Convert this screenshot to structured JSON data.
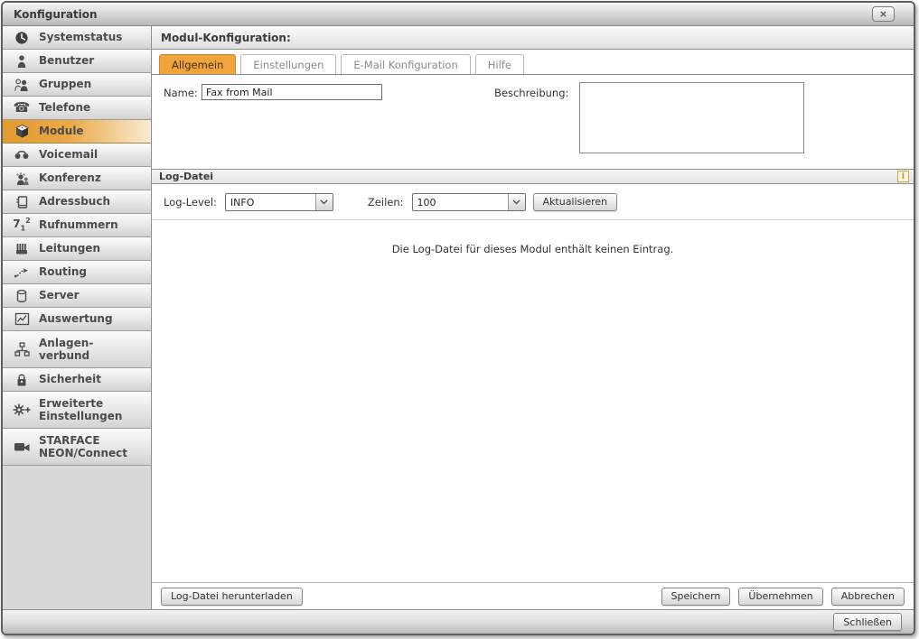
{
  "window": {
    "title": "Konfiguration",
    "close_glyph": "×"
  },
  "sidebar": {
    "items": [
      {
        "label": "Systemstatus",
        "icon": "clock-icon",
        "selected": false
      },
      {
        "label": "Benutzer",
        "icon": "user-icon",
        "selected": false
      },
      {
        "label": "Gruppen",
        "icon": "group-icon",
        "selected": false
      },
      {
        "label": "Telefone",
        "icon": "phone-icon",
        "selected": false
      },
      {
        "label": "Module",
        "icon": "cube-icon",
        "selected": true
      },
      {
        "label": "Voicemail",
        "icon": "voicemail-icon",
        "selected": false
      },
      {
        "label": "Konferenz",
        "icon": "conference-icon",
        "selected": false
      },
      {
        "label": "Adressbuch",
        "icon": "addressbook-icon",
        "selected": false
      },
      {
        "label": "Rufnummern",
        "icon": "numbers-icon",
        "selected": false
      },
      {
        "label": "Leitungen",
        "icon": "lines-icon",
        "selected": false
      },
      {
        "label": "Routing",
        "icon": "routing-icon",
        "selected": false
      },
      {
        "label": "Server",
        "icon": "server-icon",
        "selected": false
      },
      {
        "label": "Auswertung",
        "icon": "chart-icon",
        "selected": false
      },
      {
        "label": "Anlagen-\nverbund",
        "icon": "network-icon",
        "selected": false
      },
      {
        "label": "Sicherheit",
        "icon": "lock-icon",
        "selected": false
      },
      {
        "label": "Erweiterte\nEinstellungen",
        "icon": "gear-plus-icon",
        "selected": false
      },
      {
        "label": "STARFACE\nNEON/Connect",
        "icon": "camera-icon",
        "selected": false
      }
    ]
  },
  "icons": {
    "phone_glyph": "☎",
    "rufnummern_7": "7",
    "rufnummern_1": "1",
    "rufnummern_2": "2",
    "info_glyph": "i"
  },
  "main": {
    "header": "Modul-Konfiguration:",
    "tabs": [
      {
        "label": "Allgemein",
        "active": true
      },
      {
        "label": "Einstellungen",
        "active": false
      },
      {
        "label": "E-Mail Konfiguration",
        "active": false
      },
      {
        "label": "Hilfe",
        "active": false
      }
    ],
    "form": {
      "name_label": "Name:",
      "name_value": "Fax from Mail",
      "description_label": "Beschreibung:",
      "description_value": ""
    },
    "log_section": {
      "title": "Log-Datei",
      "log_level_label": "Log-Level:",
      "log_level_value": "INFO",
      "lines_label": "Zeilen:",
      "lines_value": "100",
      "refresh_button": "Aktualisieren",
      "empty_message": "Die Log-Datei für dieses Modul enthält keinen Eintrag."
    },
    "buttons": {
      "download": "Log-Datei herunterladen",
      "save": "Speichern",
      "apply": "Übernehmen",
      "cancel": "Abbrechen"
    }
  },
  "footer": {
    "close_button": "Schließen"
  },
  "colors": {
    "accent_orange": "#f1a43c",
    "selected_item_gradient_start": "#e39a2f",
    "selected_item_gradient_end": "#f8ecd4",
    "titlebar_text": "#3a3a3a",
    "info_badge_border": "#daa33c"
  }
}
